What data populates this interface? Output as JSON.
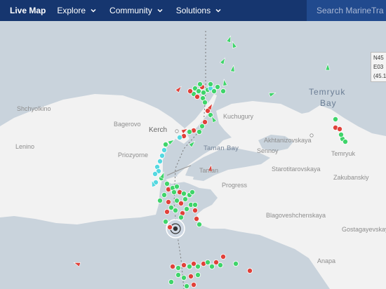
{
  "nav": {
    "brand": "Live Map",
    "items": [
      {
        "label": "Explore"
      },
      {
        "label": "Community"
      },
      {
        "label": "Solutions"
      }
    ],
    "search_placeholder": "Search MarineTra"
  },
  "coords": {
    "line1": "N45",
    "line2": "E03",
    "line3": "(45.1"
  },
  "places": {
    "shchyolkino": "Shchyolkino",
    "bagerovo": "Bagerovo",
    "kerch": "Kerch",
    "lenino": "Lenino",
    "priozyorne": "Priozyorne",
    "taman_bay": "Taman Bay",
    "taman": "Taman",
    "sennoy": "Sennoy",
    "akhtanizovskaya": "Akhtanizovskaya",
    "kuchugury": "Kuchugury",
    "temryuk_bay_1": "Temryuk",
    "temryuk_bay_2": "Bay",
    "temryuk": "Temryuk",
    "starotitarovskaya": "Starotitarovskaya",
    "zakubanskiy": "Zakubanskiy",
    "progress": "Progress",
    "blagoveshchenskaya": "Blagoveshchenskaya",
    "gostagayevskaya": "Gostagayevskaya",
    "anapa": "Anapa"
  },
  "colors": {
    "sea": "#c9d3dc",
    "land": "#f2f2f2",
    "nav_bg": "#16366f",
    "vessel_green": "#3fd46a",
    "vessel_red": "#e0413a",
    "vessel_cyan": "#55d8e0"
  }
}
